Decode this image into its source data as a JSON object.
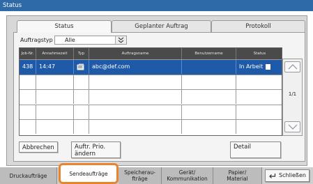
{
  "window": {
    "title": "Status"
  },
  "tabs": [
    {
      "label": "Status",
      "active": true
    },
    {
      "label": "Geplanter Auftrag",
      "active": false
    },
    {
      "label": "Protokoll",
      "active": false
    }
  ],
  "filter": {
    "label": "Auftragstyp",
    "value": "Alle"
  },
  "table": {
    "headers": [
      "Job-Nr.",
      "Annahmezeit",
      "Typ",
      "Auftragsname",
      "Benutzername",
      "Status"
    ],
    "rows": [
      {
        "job_no": "438",
        "time": "14:47",
        "type_icon": "document-icon",
        "name": "abc@def.com",
        "user": "",
        "status": "In Arbeit",
        "selected": true
      }
    ],
    "empty_rows": 5
  },
  "pagination": {
    "indicator": "1/1"
  },
  "buttons": {
    "cancel": "Abbrechen",
    "priority": "Auftr. Prio. ändern",
    "detail": "Detail"
  },
  "bottom_tabs": [
    {
      "label": "Druckaufträge",
      "active": false
    },
    {
      "label": "Sendeaufträge",
      "active": true
    },
    {
      "label": "Speicherau-ftrage",
      "line1": "Speicherau-",
      "line2": "fträge",
      "active": false
    },
    {
      "label": "Gerät/Kommunikation",
      "line1": "Gerät/",
      "line2": "Kommunikation",
      "active": false
    },
    {
      "label": "Papier/Material",
      "line1": "Papier/",
      "line2": "Material",
      "active": false
    }
  ],
  "close_button": {
    "label": "Schließen",
    "icon": "return-arrow-icon"
  },
  "colors": {
    "title_bar": "#2f6aa8",
    "selection": "#1f5aa8",
    "active_tab_outline": "#e8852c"
  }
}
